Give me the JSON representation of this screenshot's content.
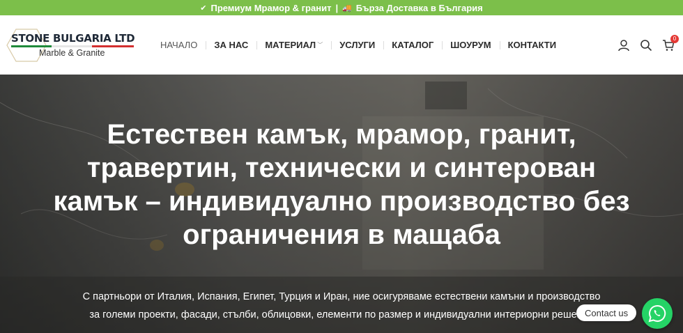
{
  "topbar": {
    "item1_icon": "check-icon",
    "item1_text": "Премиум Мрамор & гранит",
    "separator": "|",
    "item2_icon": "truck-icon",
    "item2_text": "Бърза Доставка в България"
  },
  "header": {
    "logo_name": "STONE BULGARIA LTD",
    "logo_sub": "Marble & Granite",
    "nav": [
      {
        "label": "НАЧАЛО"
      },
      {
        "label": "ЗА НАС"
      },
      {
        "label": "МАТЕРИАЛ",
        "has_dropdown": true
      },
      {
        "label": "УСЛУГИ"
      },
      {
        "label": "КАТАЛОГ"
      },
      {
        "label": "ШОУРУМ"
      },
      {
        "label": "КОНТАКТИ"
      }
    ],
    "icons": [
      "user-icon",
      "search-icon",
      "cart-icon"
    ],
    "cart_count": "0"
  },
  "hero": {
    "title": "Естествен камък, мрамор, гранит, травертин, технически и синтерован камък – индивидуално производство без ограничения в мащаба",
    "text": "С партньори от Италия, Испания, Египет, Турция и Иран, ние осигуряваме естествени камъни и производство\nза големи проекти, фасади, стълби, облицовки, елементи по размер и индивидуални интериорни решения"
  },
  "widgets": {
    "contact_label": "Contact us",
    "whatsapp_icon": "whatsapp-icon"
  },
  "colors": {
    "topbar": "#7cbf4a",
    "whatsapp": "#25d366",
    "badge": "#e53935"
  }
}
